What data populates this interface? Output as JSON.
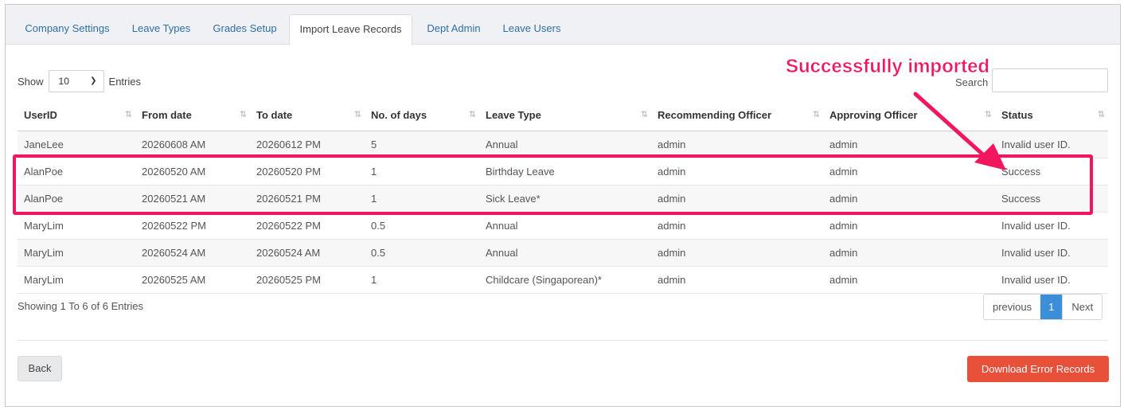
{
  "tabs": [
    {
      "label": "Company Settings",
      "active": false
    },
    {
      "label": "Leave Types",
      "active": false
    },
    {
      "label": "Grades Setup",
      "active": false
    },
    {
      "label": "Import Leave Records",
      "active": true
    },
    {
      "label": "Dept Admin",
      "active": false
    },
    {
      "label": "Leave Users",
      "active": false
    }
  ],
  "length_control": {
    "show_label": "Show",
    "value": "10",
    "entries_label": "Entries"
  },
  "search": {
    "label": "Search",
    "value": ""
  },
  "table": {
    "columns": [
      "UserID",
      "From date",
      "To date",
      "No. of days",
      "Leave Type",
      "Recommending Officer",
      "Approving Officer",
      "Status"
    ],
    "rows": [
      [
        "JaneLee",
        "20260608 AM",
        "20260612 PM",
        "5",
        "Annual",
        "admin",
        "admin",
        "Invalid user ID."
      ],
      [
        "AlanPoe",
        "20260520 AM",
        "20260520 PM",
        "1",
        "Birthday Leave",
        "admin",
        "admin",
        "Success"
      ],
      [
        "AlanPoe",
        "20260521 AM",
        "20260521 PM",
        "1",
        "Sick Leave*",
        "admin",
        "admin",
        "Success"
      ],
      [
        "MaryLim",
        "20260522 PM",
        "20260522 PM",
        "0.5",
        "Annual",
        "admin",
        "admin",
        "Invalid user ID."
      ],
      [
        "MaryLim",
        "20260524 AM",
        "20260524 AM",
        "0.5",
        "Annual",
        "admin",
        "admin",
        "Invalid user ID."
      ],
      [
        "MaryLim",
        "20260525 AM",
        "20260525 PM",
        "1",
        "Childcare (Singaporean)*",
        "admin",
        "admin",
        "Invalid user ID."
      ]
    ]
  },
  "info": "Showing 1 To 6 of 6 Entries",
  "pagination": {
    "previous": "previous",
    "current": "1",
    "next": "Next"
  },
  "buttons": {
    "back": "Back",
    "download": "Download Error Records"
  },
  "annotation": {
    "callout": "Successfully imported",
    "color": "#f2165e"
  }
}
